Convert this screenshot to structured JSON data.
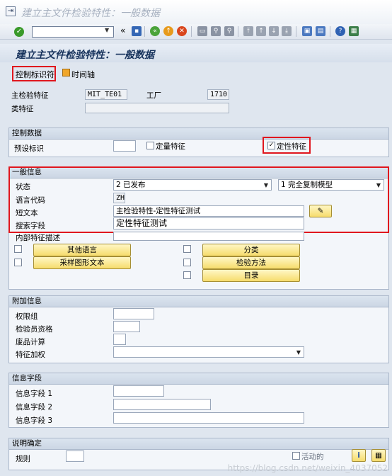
{
  "window": {
    "title": "建立主文件检验特性：一般数据"
  },
  "content_title": "建立主文件检验特性：一般数据",
  "appbar": {
    "control_key_button": "控制标识符",
    "timeline_button": "时间轴"
  },
  "header": {
    "master_char_label": "主检验特征",
    "master_char_value": "MIT_TE01",
    "plant_label": "工厂",
    "plant_value": "1710",
    "class_char_label": "类特征"
  },
  "control_data": {
    "title": "控制数据",
    "preset_label": "预设标识",
    "quantitative_label": "定量特征",
    "qualitative_label": "定性特征",
    "qualitative_checked": true
  },
  "general_info": {
    "title": "一般信息",
    "status_label": "状态",
    "status_value": "2 已发布",
    "copy_model_value": "1 完全复制模型",
    "language_label": "语言代码",
    "language_value": "ZH",
    "short_text_label": "短文本",
    "short_text_value": "主检验特性-定性特征测试",
    "search_field_label": "搜索字段",
    "search_field_value": "定性特征测试",
    "internal_desc_label": "内部特征描述",
    "other_lang_button": "其他语言",
    "sampling_button": "采样图形文本",
    "class_button": "分类",
    "method_button": "检验方法",
    "catalog_button": "目录"
  },
  "additional_info": {
    "title": "附加信息",
    "auth_group_label": "权限组",
    "inspector_label": "检验员资格",
    "scrap_label": "废品计算",
    "char_auth_label": "特征加权"
  },
  "info_fields": {
    "title": "信息字段",
    "field1_label": "信息字段 1",
    "field2_label": "信息字段 2",
    "field3_label": "信息字段 3"
  },
  "doc": {
    "title": "说明确定",
    "rule_label": "规则",
    "active_label": "活动的"
  },
  "watermark": "https://blog.csdn.net/weixin_4037052"
}
